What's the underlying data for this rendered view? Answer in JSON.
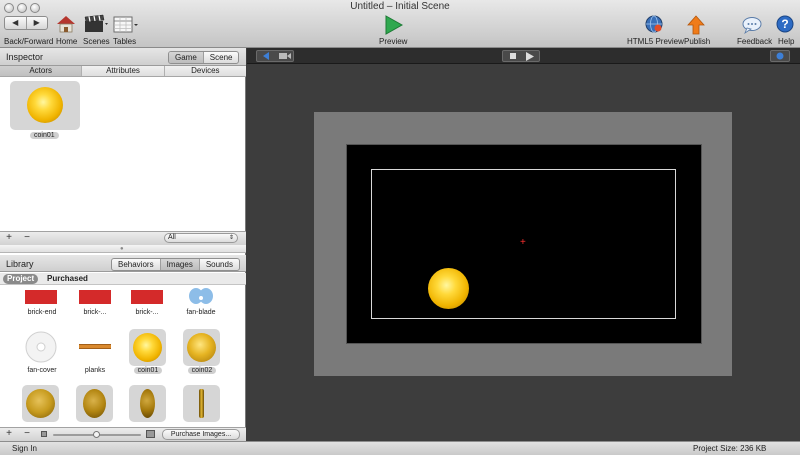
{
  "window": {
    "title": "Untitled – Initial Scene"
  },
  "toolbar": {
    "back_forward": "Back/Forward",
    "home": "Home",
    "scenes": "Scenes",
    "tables": "Tables",
    "preview": "Preview",
    "html5_preview": "HTML5 Preview",
    "publish": "Publish",
    "feedback": "Feedback",
    "help": "Help"
  },
  "inspector": {
    "title": "Inspector",
    "mode_game": "Game",
    "mode_scene": "Scene",
    "tabs": [
      "Actors",
      "Attributes",
      "Devices"
    ],
    "actor_name": "coin01",
    "filter_value": "All"
  },
  "library": {
    "title": "Library",
    "tabs": [
      "Behaviors",
      "Images",
      "Sounds"
    ],
    "subtabs": [
      "Project",
      "Purchased"
    ],
    "items_row1": [
      "brick-end",
      "brick-...",
      "brick-...",
      "fan-blade"
    ],
    "items_row2": [
      "fan-cover",
      "planks",
      "coin01",
      "coin02"
    ],
    "purchase_label": "Purchase Images..."
  },
  "status": {
    "sign_in": "Sign In",
    "project_size": "Project Size: 236 KB"
  },
  "colors": {
    "accent_green": "#2fa84f",
    "publish_orange": "#f07c1a",
    "scene_border": "#ffffff",
    "origin_marker": "#ff3030"
  }
}
